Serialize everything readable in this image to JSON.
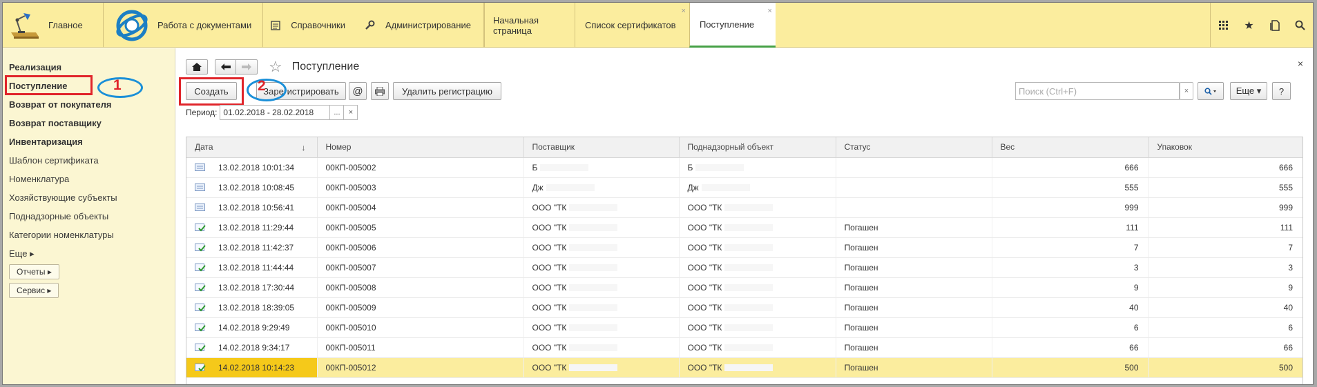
{
  "topbar": {
    "home_label": "Главное",
    "sections": [
      {
        "label": "Работа с документами"
      },
      {
        "label": "Справочники"
      },
      {
        "label": "Администрирование"
      }
    ],
    "tabs": [
      {
        "label": "Начальная страница"
      },
      {
        "label": "Список сертификатов"
      },
      {
        "label": "Поступление"
      }
    ],
    "tab_close_glyph": "×"
  },
  "sidebar": {
    "items": [
      {
        "label": "Реализация"
      },
      {
        "label": "Поступление"
      },
      {
        "label": "Возврат от покупателя"
      },
      {
        "label": "Возврат поставщику"
      },
      {
        "label": "Инвентаризация"
      },
      {
        "label": "Шаблон сертификата"
      },
      {
        "label": "Номенклатура"
      },
      {
        "label": "Хозяйствующие субъекты"
      },
      {
        "label": "Поднадзорные объекты"
      },
      {
        "label": "Категории номенклатуры"
      },
      {
        "label": "Еще ▸"
      }
    ],
    "buttons": [
      {
        "label": "Отчеты ▸"
      },
      {
        "label": "Сервис ▸"
      }
    ]
  },
  "annotations": {
    "one": "1",
    "two": "2"
  },
  "page": {
    "title": "Поступление",
    "close_glyph": "×"
  },
  "toolbar": {
    "create": "Создать",
    "register": "Зарегистрировать",
    "at": "@",
    "delete_registration": "Удалить регистрацию",
    "search_placeholder": "Поиск (Ctrl+F)",
    "search_clear": "×",
    "more": "Еще ▾",
    "help": "?"
  },
  "period": {
    "label": "Период:",
    "value": "01.02.2018 - 28.02.2018",
    "choose": "...",
    "clear": "×"
  },
  "table": {
    "columns": [
      "Дата",
      "Номер",
      "Поставщик",
      "Поднадзорный объект",
      "Статус",
      "Вес",
      "Упаковок"
    ],
    "sort_glyph": "↓",
    "rows": [
      {
        "icon": "document-icon",
        "date": "13.02.2018 10:01:34",
        "number": "00КП-005002",
        "supplier": "Б",
        "object": "Б",
        "status": "",
        "weight": "666",
        "packs": "666"
      },
      {
        "icon": "document-icon",
        "date": "13.02.2018 10:08:45",
        "number": "00КП-005003",
        "supplier": "Дж",
        "object": "Дж",
        "status": "",
        "weight": "555",
        "packs": "555"
      },
      {
        "icon": "document-icon",
        "date": "13.02.2018 10:56:41",
        "number": "00КП-005004",
        "supplier": "ООО \"ТК",
        "object": "ООО \"ТК",
        "status": "",
        "weight": "999",
        "packs": "999"
      },
      {
        "icon": "posted-document-icon",
        "date": "13.02.2018 11:29:44",
        "number": "00КП-005005",
        "supplier": "ООО \"ТК",
        "object": "ООО \"ТК",
        "status": "Погашен",
        "weight": "111",
        "packs": "111"
      },
      {
        "icon": "posted-document-icon",
        "date": "13.02.2018 11:42:37",
        "number": "00КП-005006",
        "supplier": "ООО \"ТК",
        "object": "ООО \"ТК",
        "status": "Погашен",
        "weight": "7",
        "packs": "7"
      },
      {
        "icon": "posted-document-icon",
        "date": "13.02.2018 11:44:44",
        "number": "00КП-005007",
        "supplier": "ООО \"ТК",
        "object": "ООО \"ТК",
        "status": "Погашен",
        "weight": "3",
        "packs": "3"
      },
      {
        "icon": "posted-document-icon",
        "date": "13.02.2018 17:30:44",
        "number": "00КП-005008",
        "supplier": "ООО \"ТК",
        "object": "ООО \"ТК",
        "status": "Погашен",
        "weight": "9",
        "packs": "9"
      },
      {
        "icon": "posted-document-icon",
        "date": "13.02.2018 18:39:05",
        "number": "00КП-005009",
        "supplier": "ООО \"ТК",
        "object": "ООО \"ТК",
        "status": "Погашен",
        "weight": "40",
        "packs": "40"
      },
      {
        "icon": "posted-document-icon",
        "date": "14.02.2018 9:29:49",
        "number": "00КП-005010",
        "supplier": "ООО \"ТК",
        "object": "ООО \"ТК",
        "status": "Погашен",
        "weight": "6",
        "packs": "6"
      },
      {
        "icon": "posted-document-icon",
        "date": "14.02.2018 9:34:17",
        "number": "00КП-005011",
        "supplier": "ООО \"ТК",
        "object": "ООО \"ТК",
        "status": "Погашен",
        "weight": "66",
        "packs": "66"
      },
      {
        "icon": "posted-document-icon",
        "date": "14.02.2018 10:14:23",
        "number": "00КП-005012",
        "supplier": "ООО \"ТК",
        "object": "ООО \"ТК",
        "status": "Погашен",
        "weight": "500",
        "packs": "500",
        "selected": true
      }
    ]
  },
  "colors": {
    "topbar": "#fbed9e",
    "sidebar": "#fbf6d2",
    "annotation_red": "#e0242a",
    "annotation_blue": "#1a8fd8",
    "selected_row": "#fbed9e",
    "active_tab_underline": "#46a046"
  }
}
